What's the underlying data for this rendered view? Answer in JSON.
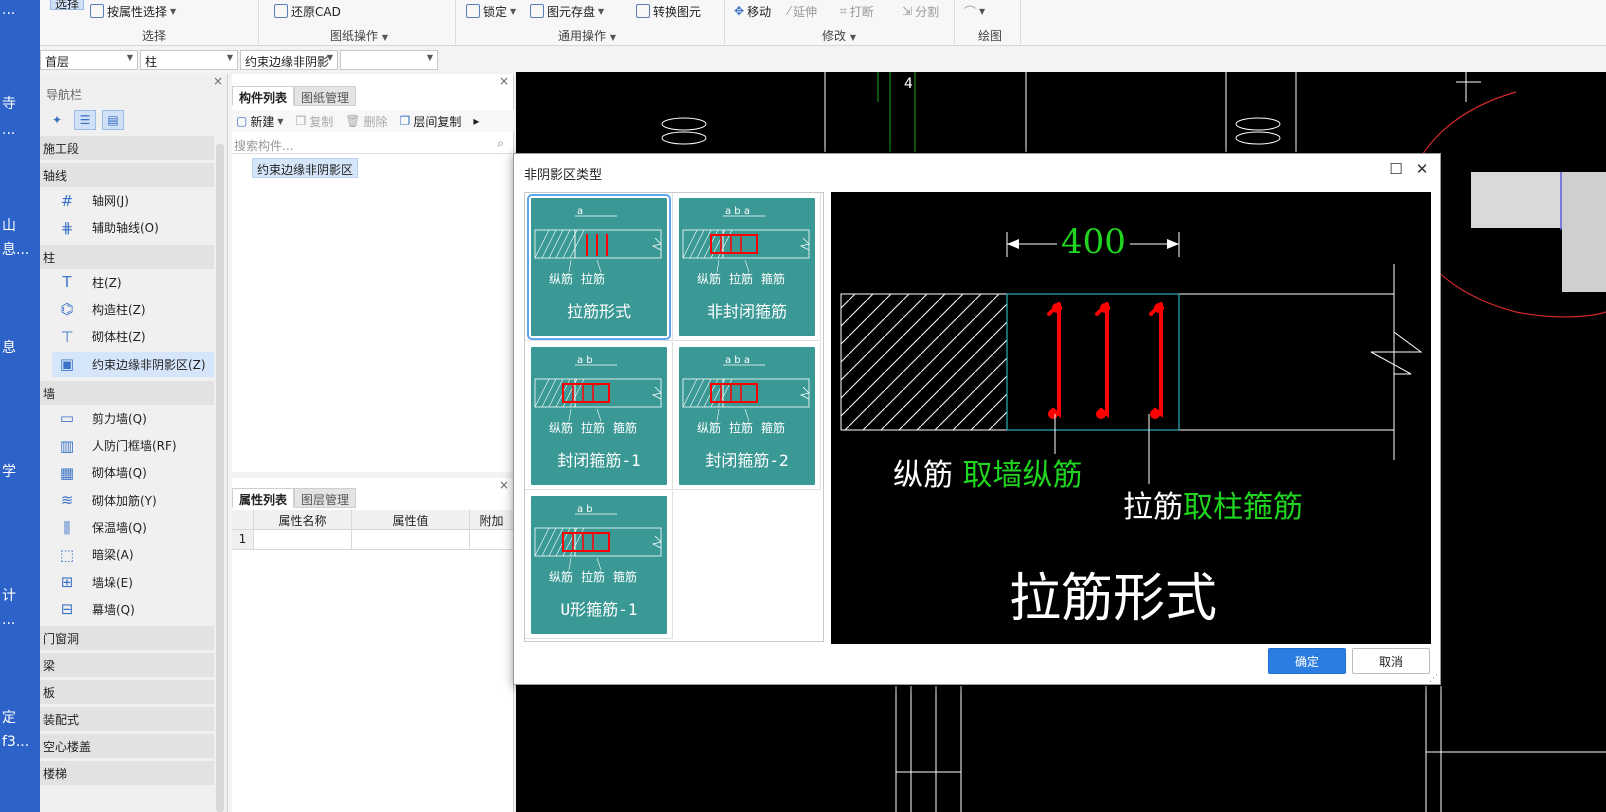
{
  "desktop": {
    "labels": [
      "...",
      "寺",
      "...",
      "山",
      "息...",
      "息",
      "学",
      "计",
      "...",
      "定",
      "f3..."
    ]
  },
  "ribbon": {
    "select_btn": "选择",
    "by_attr": "按属性选择",
    "restore_cad": "还原CAD",
    "lock": "锁定",
    "save_elem": "图元存盘",
    "convert_elem": "转换图元",
    "move": "移动",
    "extend": "延伸",
    "break": "打断",
    "split": "分割",
    "groups": {
      "select": "选择",
      "drawing_ops": "图纸操作",
      "common_ops": "通用操作",
      "modify": "修改",
      "draw": "绘图"
    }
  },
  "combos": {
    "floor": "首层",
    "type": "柱",
    "component": "约束边缘非阴影",
    "extra": ""
  },
  "nav": {
    "title": "导航栏",
    "categories": [
      {
        "label": "施工段"
      },
      {
        "label": "轴线",
        "items": [
          "轴网(J)",
          "辅助轴线(O)"
        ]
      },
      {
        "label": "柱",
        "items": [
          "柱(Z)",
          "构造柱(Z)",
          "砌体柱(Z)",
          "约束边缘非阴影区(Z)"
        ]
      },
      {
        "label": "墙",
        "items": [
          "剪力墙(Q)",
          "人防门框墙(RF)",
          "砌体墙(Q)",
          "砌体加筋(Y)",
          "保温墙(Q)",
          "暗梁(A)",
          "墙垛(E)",
          "幕墙(Q)"
        ]
      },
      {
        "label": "门窗洞"
      },
      {
        "label": "梁"
      },
      {
        "label": "板"
      },
      {
        "label": "装配式"
      },
      {
        "label": "空心楼盖"
      },
      {
        "label": "楼梯"
      }
    ]
  },
  "components": {
    "tabs": [
      "构件列表",
      "图纸管理"
    ],
    "toolbar": {
      "new": "新建",
      "copy": "复制",
      "delete": "删除",
      "floor_copy": "层间复制"
    },
    "search_placeholder": "搜索构件...",
    "item": "约束边缘非阴影区"
  },
  "props": {
    "tabs": [
      "属性列表",
      "图层管理"
    ],
    "headers": [
      "属性名称",
      "属性值",
      "附加"
    ],
    "rows": [
      [
        "1",
        "",
        ""
      ]
    ]
  },
  "cad": {
    "axis_label": "4"
  },
  "dialog": {
    "title": "非阴影区类型",
    "types": [
      {
        "label": "拉筋形式",
        "dim": "a",
        "notes": [
          "纵筋",
          "拉筋"
        ]
      },
      {
        "label": "非封闭箍筋",
        "dim": "a b a",
        "notes": [
          "纵筋",
          "拉筋",
          "箍筋"
        ]
      },
      {
        "label": "封闭箍筋-1",
        "dim": "a b",
        "notes": [
          "纵筋",
          "拉筋",
          "箍筋"
        ]
      },
      {
        "label": "封闭箍筋-2",
        "dim": "a b a",
        "notes": [
          "纵筋",
          "拉筋",
          "箍筋"
        ]
      },
      {
        "label": "U形箍筋-1",
        "dim": "a b",
        "notes": [
          "纵筋",
          "拉筋",
          "箍筋"
        ]
      }
    ],
    "preview": {
      "dimension": "400",
      "long_bar": "纵筋",
      "long_bar_rule": "取墙纵筋",
      "tie_bar": "拉筋",
      "tie_bar_rule": "取柱箍筋",
      "title": "拉筋形式"
    },
    "ok": "确定",
    "cancel": "取消"
  }
}
